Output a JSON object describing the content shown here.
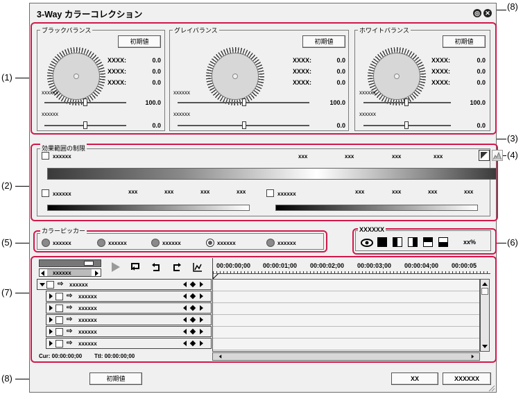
{
  "dialog": {
    "title": "3-Way カラーコレクション"
  },
  "callouts": {
    "c1": "(1)",
    "c2": "(2)",
    "c3": "(3)",
    "c4": "(4)",
    "c5": "(5)",
    "c6": "(6)",
    "c7": "(7)",
    "c8_top": "(8)",
    "c8_bottom": "(8)"
  },
  "balance": {
    "reset_label": "初期値",
    "black": {
      "title": "ブラックバランス",
      "rows": [
        [
          "XXXX:",
          "0.0"
        ],
        [
          "XXXX:",
          "0.0"
        ],
        [
          "XXXX:",
          "0.0"
        ]
      ],
      "slider1_label": "xxxxxx",
      "slider1_value": "100.0",
      "slider2_label": "xxxxxx",
      "slider2_value": "0.0"
    },
    "gray": {
      "title": "グレイバランス",
      "rows": [
        [
          "XXXX:",
          "0.0"
        ],
        [
          "XXXX:",
          "0.0"
        ],
        [
          "XXXX:",
          "0.0"
        ]
      ],
      "slider1_label": "xxxxxx",
      "slider1_value": "100.0",
      "slider2_label": "xxxxxx",
      "slider2_value": "0.0"
    },
    "white": {
      "title": "ホワイトバランス",
      "rows": [
        [
          "XXXX:",
          "0.0"
        ],
        [
          "XXXX:",
          "0.0"
        ],
        [
          "XXXX:",
          "0.0"
        ]
      ],
      "slider1_label": "xxxxxx",
      "slider1_value": "100.0",
      "slider2_label": "xxxxxx",
      "slider2_value": "0.0"
    }
  },
  "effect_range": {
    "title": "効果範囲の制限",
    "main_checkbox": "xxxxxx",
    "main_values": [
      "xxx",
      "xxx",
      "xxx",
      "xxx"
    ],
    "left_checkbox": "xxxxxx",
    "left_values": [
      "xxx",
      "xxx",
      "xxx",
      "xxx"
    ],
    "right_checkbox": "xxxxxx",
    "right_values": [
      "xxx",
      "xxx",
      "xxx",
      "xxx"
    ]
  },
  "color_picker": {
    "title": "カラーピッカー",
    "options": [
      "xxxxxx",
      "xxxxxx",
      "xxxxxx",
      "xxxxxx",
      "xxxxxx"
    ],
    "selected_index": 3
  },
  "preview": {
    "title": "XXXXXX",
    "percent": "xx%"
  },
  "timeline": {
    "dropdown": "xxxxxx",
    "timecodes": [
      "00:00:00;00",
      "00:00:01;00",
      "00:00:02;00",
      "00:00:03;00",
      "00:00:04;00",
      "00:00:05"
    ],
    "tracks": [
      "xxxxxx",
      "xxxxxx",
      "xxxxxx",
      "xxxxxx",
      "xxxxxx",
      "xxxxxx"
    ],
    "cur": "Cur: 00:00:00;00",
    "ttl": "Ttl: 00:00:00;00"
  },
  "footer": {
    "reset_label": "初期値",
    "ok_label": "XX",
    "cancel_label": "XXXXXX"
  }
}
